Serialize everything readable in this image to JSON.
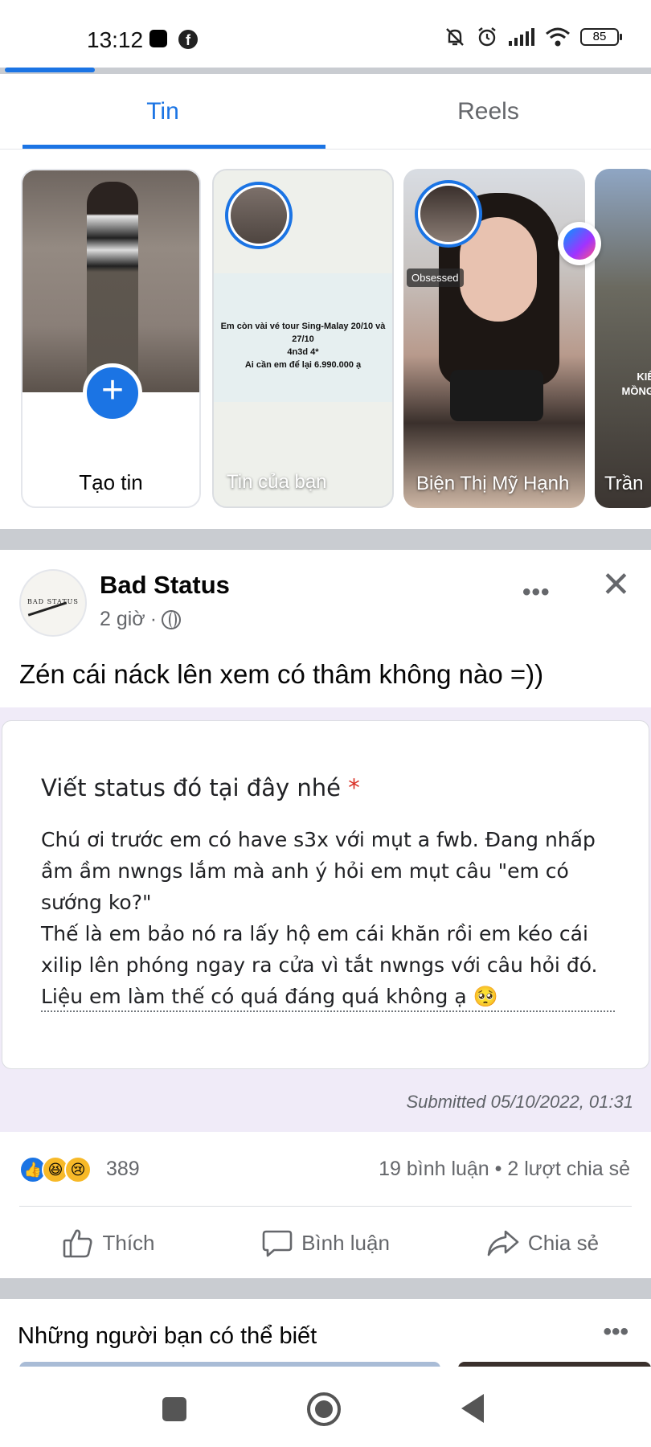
{
  "status_bar": {
    "time": "13:12",
    "battery": "85"
  },
  "tabs": [
    {
      "label": "Tin"
    },
    {
      "label": "Reels"
    }
  ],
  "stories": {
    "create_label": "Tạo tin",
    "items": [
      {
        "label": "Tin của bạn",
        "text": "Em còn vài vé tour Sing-Malay 20/10 và 27/10\n4n3d 4*\nAi cần em để lại 6.990.000 ạ"
      },
      {
        "label": "Biện Thị Mỹ Hạnh",
        "music_tag": "Obsessed"
      },
      {
        "label": "Trần",
        "text": "KIÊ\nMỒNG"
      }
    ]
  },
  "post": {
    "page_name": "Bad Status",
    "time": "2 giờ",
    "separator": "·",
    "logo_text": "BAD STATUS",
    "text": "Zén cái náck lên xem có thâm không nào =))",
    "form": {
      "question": "Viết status đó tại đây nhé",
      "required_mark": "*",
      "answer_lines": [
        "Chú ơi trước em có have s3x với mụt a fwb. Đang nhấp",
        "ầm ầm nwngs lắm mà anh ý hỏi em mụt câu \"em có",
        "sướng ko?\"",
        "Thế là em bảo nó ra lấy hộ em cái khăn rồi em kéo cái",
        "xilip lên phóng ngay ra cửa vì tắt nwngs với câu hỏi đó.",
        "Liệu em làm thế có quá đáng quá không ạ 🥺"
      ],
      "submitted": "Submitted 05/10/2022, 01:31"
    },
    "reactions": {
      "count": "389",
      "icons": [
        "like-icon",
        "haha-icon",
        "sad-icon"
      ],
      "comments_shares": "19 bình luận • 2 lượt chia sẻ"
    },
    "actions": {
      "like": "Thích",
      "comment": "Bình luận",
      "share": "Chia sẻ"
    }
  },
  "suggestions": {
    "title": "Những người bạn có thể biết"
  },
  "colors": {
    "accent": "#1b74e4",
    "secondary_text": "#65676b",
    "separator": "#c9ccd1",
    "form_bg": "#f0ebf8"
  }
}
